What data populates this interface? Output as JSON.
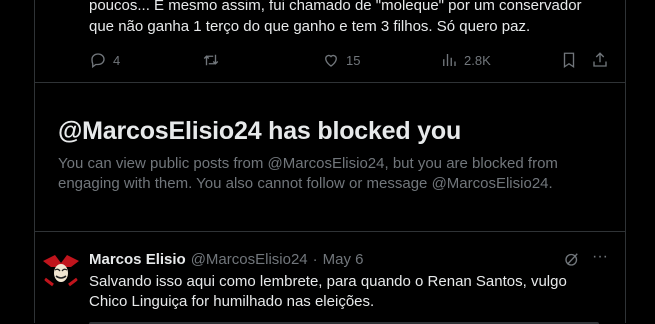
{
  "prev_tweet": {
    "text_line1": "poucos... E mesmo assim, fui chamado de \"moleque\" por um conservador",
    "text_line2": "que não ganha 1 terço do que ganho e tem 3 filhos. Só quero paz.",
    "replies": "4",
    "likes": "15",
    "views": "2.8K"
  },
  "blocked_notice": {
    "title": "@MarcosElisio24 has blocked you",
    "body": "You can view public posts from @MarcosElisio24, but you are blocked from engaging with them. You also cannot follow or message @MarcosElisio24."
  },
  "reply_tweet": {
    "author_name": "Marcos Elisio",
    "handle": "@MarcosElisio24",
    "separator": "·",
    "date": "May 6",
    "text": "Salvando isso aqui como lembrete, para quando o Renan Santos, vulgo Chico Linguiça for humilhado nas eleições.",
    "more_symbol": "···"
  },
  "icons": [
    "reply-icon",
    "retweet-icon",
    "like-icon",
    "views-icon",
    "bookmark-icon",
    "share-icon",
    "grok-icon",
    "more-icon"
  ],
  "colors": {
    "background": "#000000",
    "text": "#e7e9ea",
    "muted": "#71767b",
    "border": "#2f3336"
  }
}
